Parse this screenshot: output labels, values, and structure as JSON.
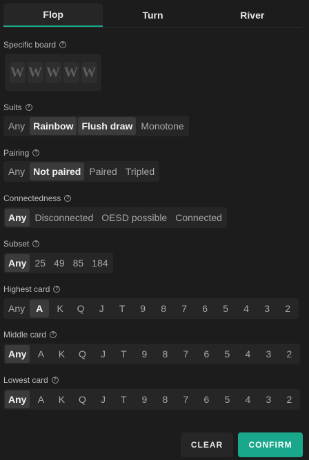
{
  "tabs": [
    {
      "label": "Flop",
      "active": true
    },
    {
      "label": "Turn",
      "active": false
    },
    {
      "label": "River",
      "active": false
    }
  ],
  "help_glyph": "?",
  "specific_board": {
    "label": "Specific board",
    "slots": [
      "W",
      "W",
      "W",
      "W",
      "W"
    ]
  },
  "suits": {
    "label": "Suits",
    "options": [
      "Any",
      "Rainbow",
      "Flush draw",
      "Monotone"
    ],
    "selected": [
      "Rainbow",
      "Flush draw"
    ]
  },
  "pairing": {
    "label": "Pairing",
    "options": [
      "Any",
      "Not paired",
      "Paired",
      "Tripled"
    ],
    "selected": [
      "Not paired"
    ]
  },
  "connectedness": {
    "label": "Connectedness",
    "options": [
      "Any",
      "Disconnected",
      "OESD possible",
      "Connected"
    ],
    "selected": [
      "Any"
    ]
  },
  "subset": {
    "label": "Subset",
    "options": [
      "Any",
      "25",
      "49",
      "85",
      "184"
    ],
    "selected": [
      "Any"
    ]
  },
  "highest_card": {
    "label": "Highest card",
    "options": [
      "Any",
      "A",
      "K",
      "Q",
      "J",
      "T",
      "9",
      "8",
      "7",
      "6",
      "5",
      "4",
      "3",
      "2"
    ],
    "selected": [
      "A"
    ]
  },
  "middle_card": {
    "label": "Middle card",
    "options": [
      "Any",
      "A",
      "K",
      "Q",
      "J",
      "T",
      "9",
      "8",
      "7",
      "6",
      "5",
      "4",
      "3",
      "2"
    ],
    "selected": [
      "Any"
    ]
  },
  "lowest_card": {
    "label": "Lowest card",
    "options": [
      "Any",
      "A",
      "K",
      "Q",
      "J",
      "T",
      "9",
      "8",
      "7",
      "6",
      "5",
      "4",
      "3",
      "2"
    ],
    "selected": [
      "Any"
    ]
  },
  "buttons": {
    "clear": "CLEAR",
    "confirm": "CONFIRM"
  },
  "colors": {
    "accent": "#1aa88c",
    "background": "#1c1c1c",
    "selected_bg": "#3b3b3b"
  }
}
